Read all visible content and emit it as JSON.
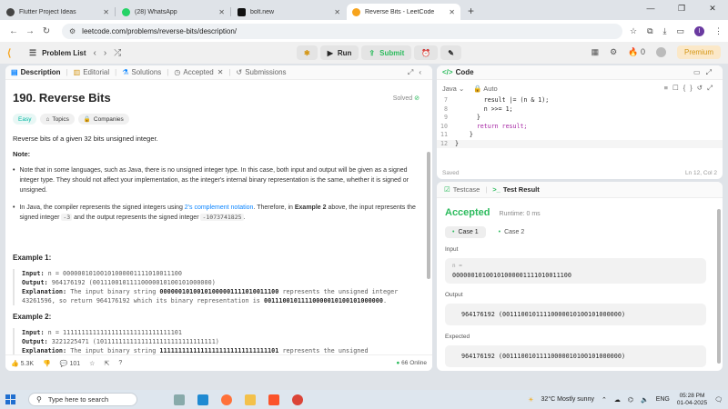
{
  "browser": {
    "tabs": [
      {
        "title": "Flutter Project Ideas",
        "icon": "chatgpt-icon",
        "color": "#444444"
      },
      {
        "title": "(28) WhatsApp",
        "icon": "whatsapp-icon",
        "color": "#25d366"
      },
      {
        "title": "bolt.new",
        "icon": "bolt-icon",
        "color": "#111111"
      },
      {
        "title": "Reverse Bits - LeetCode",
        "icon": "leetcode-icon",
        "color": "#f7a41d"
      }
    ],
    "url": "leetcode.com/problems/reverse-bits/description/",
    "profile_initial": "I"
  },
  "lc": {
    "problem_list": "Problem List",
    "run": "Run",
    "submit": "Submit",
    "streak": "0",
    "premium": "Premium"
  },
  "left": {
    "tabs": {
      "description": "Description",
      "editorial": "Editorial",
      "solutions": "Solutions",
      "accepted": "Accepted",
      "submissions": "Submissions"
    },
    "title": "190. Reverse Bits",
    "solved": "Solved",
    "chips": {
      "difficulty": "Easy",
      "topics": "Topics",
      "companies": "Companies"
    },
    "description": "Reverse bits of a given 32 bits unsigned integer.",
    "note": "Note:",
    "bullet1": "Note that in some languages, such as Java, there is no unsigned integer type. In this case, both input and output will be given as a signed integer type. They should not affect your implementation, as the integer's internal binary representation is the same, whether it is signed or unsigned.",
    "bullet2_a": "In Java, the compiler represents the signed integers using ",
    "bullet2_link": "2's complement notation",
    "bullet2_b": ". Therefore, in ",
    "bullet2_bold": "Example 2",
    "bullet2_c": " above, the input represents the signed integer ",
    "bullet2_code1": "-3",
    "bullet2_d": " and the output represents the signed integer ",
    "bullet2_code2": "-1073741825",
    "bullet2_e": ".",
    "ex1": {
      "heading": "Example 1:",
      "input_label": "Input:",
      "input": " n = 00000010100101000001111010011100",
      "output_label": "Output:",
      "output": "    964176192 (00111001011110000010100101000000)",
      "expl_label": "Explanation:",
      "expl_a": " The input binary string ",
      "expl_bold1": "00000010100101000001111010011100",
      "expl_b": " represents the unsigned integer 43261596, so return 964176192 which its binary representation is ",
      "expl_bold2": "00111001011110000010100101000000",
      "expl_c": "."
    },
    "ex2": {
      "heading": "Example 2:",
      "input_label": "Input:",
      "input": " n = 11111111111111111111111111111101",
      "output_label": "Output:",
      "output": "   3221225471 (10111111111111111111111111111111)",
      "expl_label": "Explanation:",
      "expl_a": " The input binary string ",
      "expl_bold1": "11111111111111111111111111111101",
      "expl_b": " represents the unsigned"
    },
    "footer": {
      "likes": "5.3K",
      "comments": "101",
      "online": "66 Online"
    }
  },
  "code": {
    "header": "Code",
    "language": "Java",
    "mode": "Auto",
    "lines": [
      {
        "n": "7",
        "text": "        result |= (n & 1);"
      },
      {
        "n": "8",
        "text": "        n >>= 1;"
      },
      {
        "n": "9",
        "text": "      }"
      },
      {
        "n": "10",
        "text": "      return result;"
      },
      {
        "n": "11",
        "text": "    }"
      },
      {
        "n": "12",
        "text": "}"
      }
    ],
    "status": "Saved",
    "position": "Ln 12, Col 2"
  },
  "test": {
    "tab_testcase": "Testcase",
    "tab_result": "Test Result",
    "verdict": "Accepted",
    "runtime": "Runtime: 0 ms",
    "cases": [
      "Case 1",
      "Case 2"
    ],
    "input_label": "Input",
    "input_var": "n =",
    "input_value": "00000010100101000001111010011100",
    "output_label": "Output",
    "output_value": "964176192 (00111001011110000010100101000000)",
    "expected_label": "Expected",
    "expected_value": "964176192 (00111001011110000010100101000000)"
  },
  "taskbar": {
    "search_placeholder": "Type here to search",
    "weather": "32°C  Mostly sunny",
    "lang": "ENG",
    "time": "05:28 PM",
    "date": "01-04-2025"
  }
}
